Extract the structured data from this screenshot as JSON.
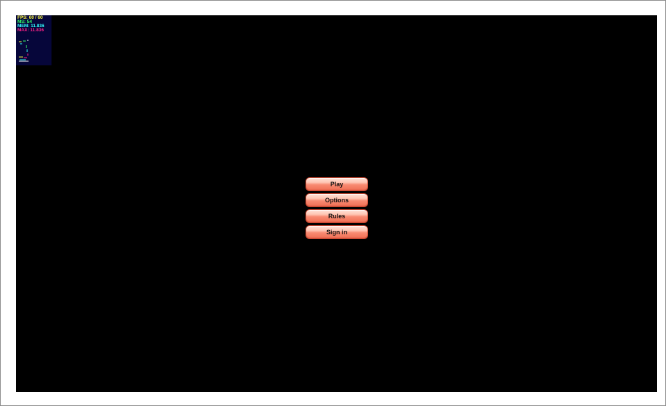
{
  "stats": {
    "fps": "FPS: 60 / 60",
    "ms": "MS: 54",
    "mem": "MEM: 11.836",
    "max": "MAX: 11.836",
    "colors": {
      "fps": "#ffff44",
      "ms": "#33ff66",
      "mem": "#33ffff",
      "max": "#ff2288",
      "panel_bg": "#06063a"
    }
  },
  "menu": {
    "buttons": [
      {
        "label": "Play"
      },
      {
        "label": "Options"
      },
      {
        "label": "Rules"
      },
      {
        "label": "Sign in"
      }
    ]
  },
  "colors": {
    "canvas_bg": "#000000",
    "button_top": "#ffe3d9",
    "button_bottom": "#f06e54",
    "button_border": "#c7452e"
  }
}
